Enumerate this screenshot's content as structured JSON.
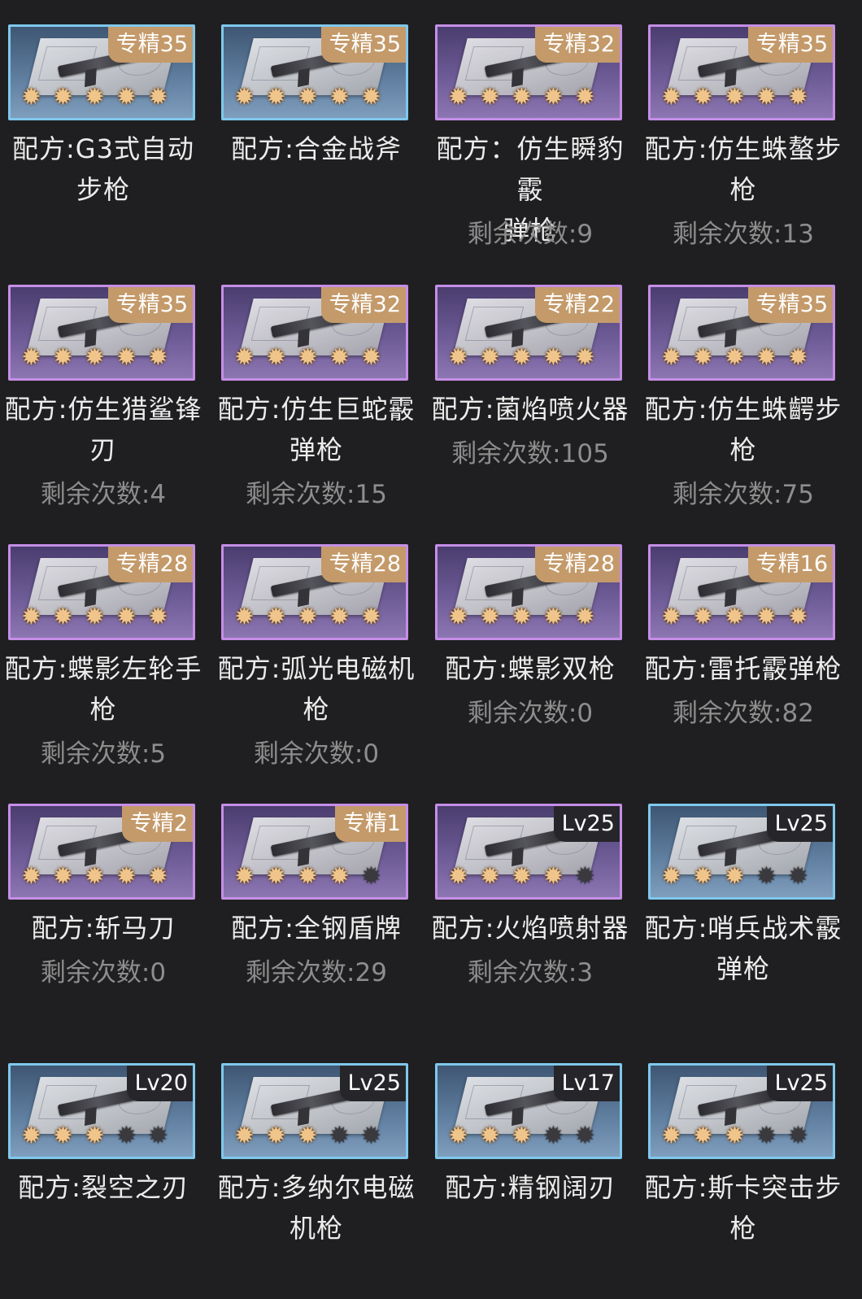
{
  "items": [
    {
      "badge": "专精35",
      "blue": true,
      "stars": 5,
      "name": "配方:G3式自动步枪",
      "remain": ""
    },
    {
      "badge": "专精35",
      "blue": true,
      "stars": 5,
      "name": "配方:合金战斧",
      "remain": ""
    },
    {
      "badge": "专精32",
      "blue": false,
      "stars": 5,
      "name": "配方：仿生瞬豹霰弹枪",
      "remain": "剩余次数:9"
    },
    {
      "badge": "专精35",
      "blue": false,
      "stars": 5,
      "name": "配方:仿生蛛螯步枪",
      "remain": "剩余次数:13"
    },
    {
      "badge": "专精35",
      "blue": false,
      "stars": 5,
      "name": "配方:仿生猎鲨锋刃",
      "remain": "剩余次数:4"
    },
    {
      "badge": "专精32",
      "blue": false,
      "stars": 5,
      "name": "配方:仿生巨蛇霰弹枪",
      "remain": "剩余次数:15"
    },
    {
      "badge": "专精22",
      "blue": false,
      "stars": 5,
      "name": "配方:菌焰喷火器",
      "remain": "剩余次数:105"
    },
    {
      "badge": "专精35",
      "blue": false,
      "stars": 5,
      "name": "配方:仿生蛛齶步枪",
      "remain": "剩余次数:75"
    },
    {
      "badge": "专精28",
      "blue": false,
      "stars": 5,
      "name": "配方:蝶影左轮手枪",
      "remain": "剩余次数:5"
    },
    {
      "badge": "专精28",
      "blue": false,
      "stars": 5,
      "name": "配方:弧光电磁机枪",
      "remain": "剩余次数:0"
    },
    {
      "badge": "专精28",
      "blue": false,
      "stars": 5,
      "name": "配方:蝶影双枪",
      "remain": "剩余次数:0"
    },
    {
      "badge": "专精16",
      "blue": false,
      "stars": 5,
      "name": "配方:雷托霰弹枪",
      "remain": "剩余次数:82"
    },
    {
      "badge": "专精2",
      "blue": false,
      "stars": 5,
      "name": "配方:斩马刀",
      "remain": "剩余次数:0"
    },
    {
      "badge": "专精1",
      "blue": false,
      "stars": 4,
      "name": "配方:全钢盾牌",
      "remain": "剩余次数:29"
    },
    {
      "badge": "Lv25",
      "blue": false,
      "stars": 4,
      "name": "配方:火焰喷射器",
      "remain": "剩余次数:3"
    },
    {
      "badge": "Lv25",
      "blue": true,
      "stars": 3,
      "name": "配方:哨兵战术霰弹枪",
      "remain": ""
    },
    {
      "badge": "Lv20",
      "blue": true,
      "stars": 3,
      "name": "配方:裂空之刃",
      "remain": ""
    },
    {
      "badge": "Lv25",
      "blue": true,
      "stars": 3,
      "name": "配方:多纳尔电磁机枪",
      "remain": ""
    },
    {
      "badge": "Lv17",
      "blue": true,
      "stars": 3,
      "name": "配方:精钢阔刃",
      "remain": ""
    },
    {
      "badge": "Lv25",
      "blue": true,
      "stars": 3,
      "name": "配方:斯卡突击步枪",
      "remain": ""
    }
  ],
  "colors": {
    "background": "#1f1f21",
    "purple_border": "#c58ee6",
    "blue_border": "#7fc8ec",
    "badge_gold": "#c49a6a",
    "badge_dark": "#26262a",
    "star_gold": "#f0c58b",
    "name_text": "#ececec",
    "remain_text": "#8d8d8d"
  }
}
